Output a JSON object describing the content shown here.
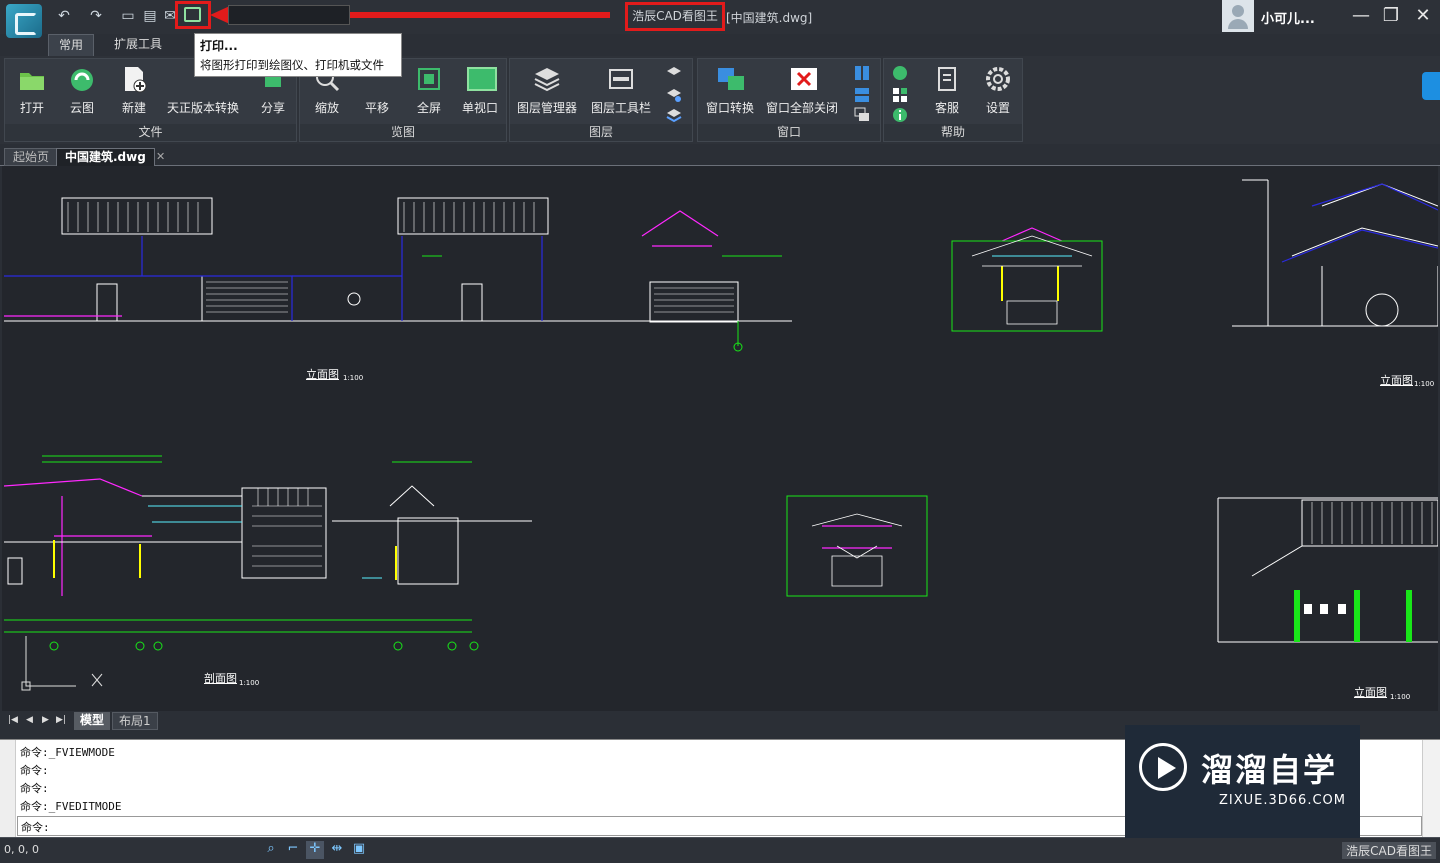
{
  "titlebar": {
    "app_title": "浩辰CAD看图王",
    "doc_title": "[中国建筑.dwg]",
    "user_name": "小可儿..."
  },
  "ribbon_tabs": [
    "常用",
    "扩展工具"
  ],
  "tooltip": {
    "title": "打印...",
    "description": "将图形打印到绘图仪、打印机或文件"
  },
  "ribbon": {
    "file_group": {
      "label": "文件",
      "buttons": [
        "打开",
        "云图",
        "新建",
        "天正版本转换",
        "分享"
      ]
    },
    "view_group": {
      "label": "览图",
      "buttons": [
        "缩放",
        "平移",
        "全屏",
        "单视口"
      ]
    },
    "layer_group": {
      "label": "图层",
      "buttons": [
        "图层管理器",
        "图层工具栏"
      ]
    },
    "window_group": {
      "label": "窗口",
      "buttons": [
        "窗口转换",
        "窗口全部关闭"
      ]
    },
    "help_group": {
      "label": "帮助",
      "buttons": [
        "客服",
        "设置"
      ]
    }
  },
  "doc_tabs": {
    "start": "起始页",
    "current": "中国建筑.dwg"
  },
  "drawing_labels": {
    "elev_1": "立面图",
    "elev_2": "立面图",
    "elev_3": "立面图",
    "section": "剖面图",
    "scale": "1:100"
  },
  "layout_tabs": [
    "模型",
    "布局1"
  ],
  "command_lines": [
    "命令:_FVIEWMODE",
    "命令:",
    "命令:",
    "命令:_FVEDITMODE"
  ],
  "command_prompt": "命令:",
  "watermark": {
    "cn": "溜溜自学",
    "en": "ZIXUE.3D66.COM"
  },
  "status": {
    "coords": "0, 0, 0",
    "app_label": "浩辰CAD看图王"
  },
  "colors": {
    "highlight": "#e21b1b",
    "canvas": "#23262c",
    "drawing_white": "#ffffff",
    "drawing_green": "#19e619",
    "drawing_magenta": "#ff28ff"
  }
}
